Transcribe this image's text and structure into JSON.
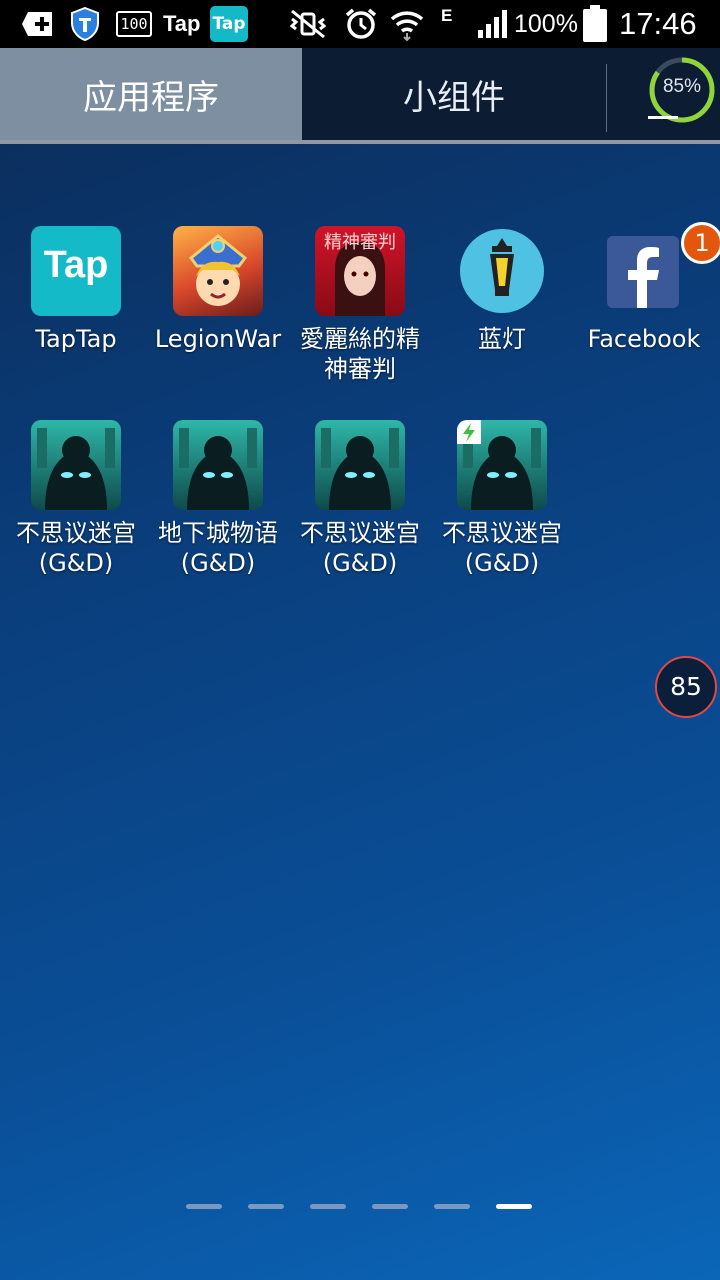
{
  "status_bar": {
    "nine_box": "100",
    "tap_text": "Tap",
    "tap_badge": "Tap",
    "network": "E",
    "battery": "100%",
    "time": "17:46"
  },
  "tabs": {
    "apps_label": "应用程序",
    "widgets_label": "小组件",
    "storage_percent": "85%"
  },
  "apps": [
    {
      "label": "TapTap",
      "icon_text": "Tap"
    },
    {
      "label": "LegionWar"
    },
    {
      "label": "愛麗絲的精神審判",
      "icon_text": "精神審判"
    },
    {
      "label": "蓝灯"
    },
    {
      "label": "Facebook",
      "badge": "1"
    },
    {
      "label": "不思议迷宫(G&D)"
    },
    {
      "label": "地下城物语(G&D)"
    },
    {
      "label": "不思议迷宫(G&D)"
    },
    {
      "label": "不思议迷宫(G&D)"
    }
  ],
  "floating_badge": "85",
  "page_indicator": {
    "pages": 6,
    "active": 6
  }
}
